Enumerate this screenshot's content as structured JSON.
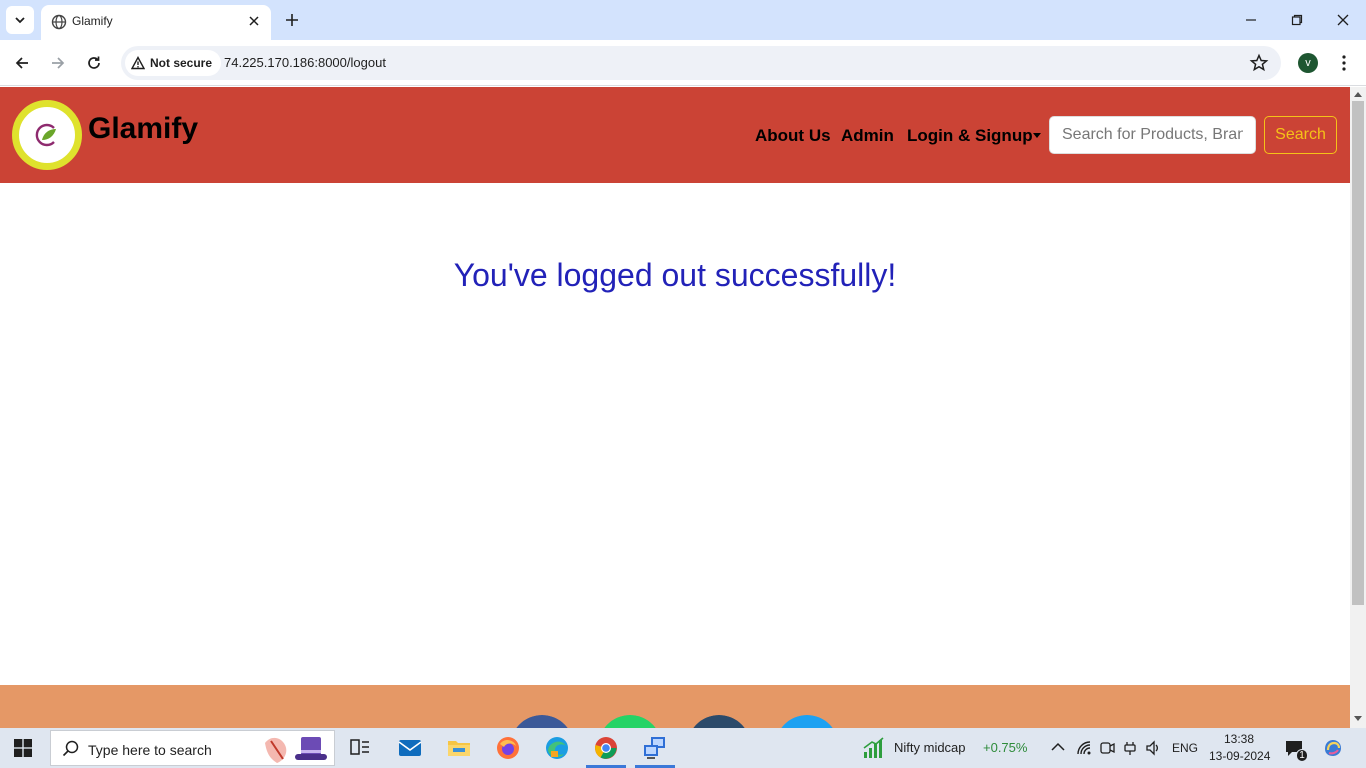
{
  "browser": {
    "tab_title": "Glamify",
    "security_label": "Not secure",
    "url": "74.225.170.186:8000/logout",
    "profile_initial": "v"
  },
  "site": {
    "brand": "Glamify",
    "nav": {
      "about": "About Us",
      "admin": "Admin",
      "login": "Login & Signup"
    },
    "search": {
      "placeholder": "Search for Products, Brands",
      "button": "Search"
    },
    "message": "You've logged out successfully!",
    "colors": {
      "header": "#cb4335",
      "footer": "#e59866",
      "message": "#2222b8",
      "logo_ring": "#dfe22d",
      "search_button": "#f5c218"
    }
  },
  "taskbar": {
    "search_placeholder": "Type here to search",
    "widget_name": "Nifty midcap",
    "widget_change": "+0.75%",
    "language": "ENG",
    "time": "13:38",
    "date": "13-09-2024",
    "notification_count": "1"
  }
}
